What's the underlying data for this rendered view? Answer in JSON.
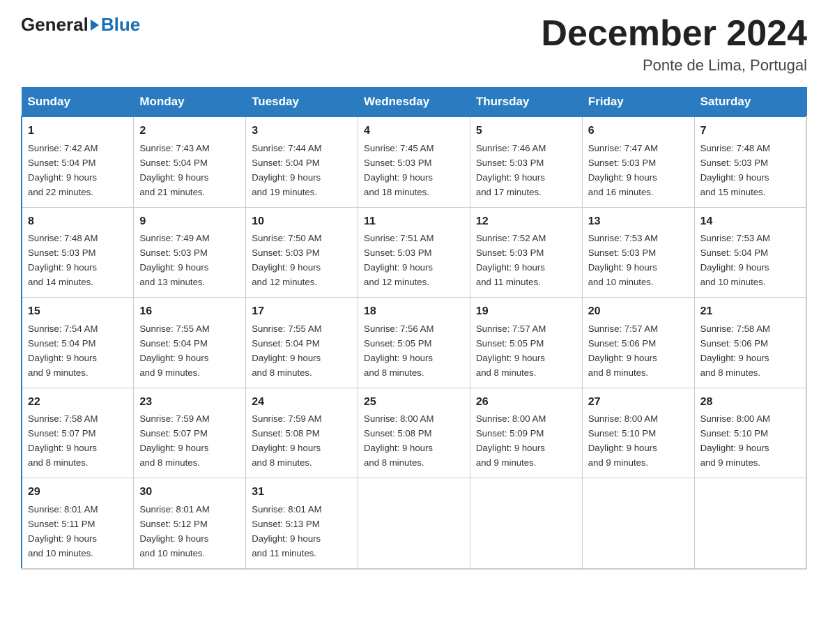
{
  "header": {
    "logo_general": "General",
    "logo_blue": "Blue",
    "title": "December 2024",
    "location": "Ponte de Lima, Portugal"
  },
  "days_of_week": [
    "Sunday",
    "Monday",
    "Tuesday",
    "Wednesday",
    "Thursday",
    "Friday",
    "Saturday"
  ],
  "weeks": [
    [
      {
        "day": "1",
        "info": "Sunrise: 7:42 AM\nSunset: 5:04 PM\nDaylight: 9 hours\nand 22 minutes."
      },
      {
        "day": "2",
        "info": "Sunrise: 7:43 AM\nSunset: 5:04 PM\nDaylight: 9 hours\nand 21 minutes."
      },
      {
        "day": "3",
        "info": "Sunrise: 7:44 AM\nSunset: 5:04 PM\nDaylight: 9 hours\nand 19 minutes."
      },
      {
        "day": "4",
        "info": "Sunrise: 7:45 AM\nSunset: 5:03 PM\nDaylight: 9 hours\nand 18 minutes."
      },
      {
        "day": "5",
        "info": "Sunrise: 7:46 AM\nSunset: 5:03 PM\nDaylight: 9 hours\nand 17 minutes."
      },
      {
        "day": "6",
        "info": "Sunrise: 7:47 AM\nSunset: 5:03 PM\nDaylight: 9 hours\nand 16 minutes."
      },
      {
        "day": "7",
        "info": "Sunrise: 7:48 AM\nSunset: 5:03 PM\nDaylight: 9 hours\nand 15 minutes."
      }
    ],
    [
      {
        "day": "8",
        "info": "Sunrise: 7:48 AM\nSunset: 5:03 PM\nDaylight: 9 hours\nand 14 minutes."
      },
      {
        "day": "9",
        "info": "Sunrise: 7:49 AM\nSunset: 5:03 PM\nDaylight: 9 hours\nand 13 minutes."
      },
      {
        "day": "10",
        "info": "Sunrise: 7:50 AM\nSunset: 5:03 PM\nDaylight: 9 hours\nand 12 minutes."
      },
      {
        "day": "11",
        "info": "Sunrise: 7:51 AM\nSunset: 5:03 PM\nDaylight: 9 hours\nand 12 minutes."
      },
      {
        "day": "12",
        "info": "Sunrise: 7:52 AM\nSunset: 5:03 PM\nDaylight: 9 hours\nand 11 minutes."
      },
      {
        "day": "13",
        "info": "Sunrise: 7:53 AM\nSunset: 5:03 PM\nDaylight: 9 hours\nand 10 minutes."
      },
      {
        "day": "14",
        "info": "Sunrise: 7:53 AM\nSunset: 5:04 PM\nDaylight: 9 hours\nand 10 minutes."
      }
    ],
    [
      {
        "day": "15",
        "info": "Sunrise: 7:54 AM\nSunset: 5:04 PM\nDaylight: 9 hours\nand 9 minutes."
      },
      {
        "day": "16",
        "info": "Sunrise: 7:55 AM\nSunset: 5:04 PM\nDaylight: 9 hours\nand 9 minutes."
      },
      {
        "day": "17",
        "info": "Sunrise: 7:55 AM\nSunset: 5:04 PM\nDaylight: 9 hours\nand 8 minutes."
      },
      {
        "day": "18",
        "info": "Sunrise: 7:56 AM\nSunset: 5:05 PM\nDaylight: 9 hours\nand 8 minutes."
      },
      {
        "day": "19",
        "info": "Sunrise: 7:57 AM\nSunset: 5:05 PM\nDaylight: 9 hours\nand 8 minutes."
      },
      {
        "day": "20",
        "info": "Sunrise: 7:57 AM\nSunset: 5:06 PM\nDaylight: 9 hours\nand 8 minutes."
      },
      {
        "day": "21",
        "info": "Sunrise: 7:58 AM\nSunset: 5:06 PM\nDaylight: 9 hours\nand 8 minutes."
      }
    ],
    [
      {
        "day": "22",
        "info": "Sunrise: 7:58 AM\nSunset: 5:07 PM\nDaylight: 9 hours\nand 8 minutes."
      },
      {
        "day": "23",
        "info": "Sunrise: 7:59 AM\nSunset: 5:07 PM\nDaylight: 9 hours\nand 8 minutes."
      },
      {
        "day": "24",
        "info": "Sunrise: 7:59 AM\nSunset: 5:08 PM\nDaylight: 9 hours\nand 8 minutes."
      },
      {
        "day": "25",
        "info": "Sunrise: 8:00 AM\nSunset: 5:08 PM\nDaylight: 9 hours\nand 8 minutes."
      },
      {
        "day": "26",
        "info": "Sunrise: 8:00 AM\nSunset: 5:09 PM\nDaylight: 9 hours\nand 9 minutes."
      },
      {
        "day": "27",
        "info": "Sunrise: 8:00 AM\nSunset: 5:10 PM\nDaylight: 9 hours\nand 9 minutes."
      },
      {
        "day": "28",
        "info": "Sunrise: 8:00 AM\nSunset: 5:10 PM\nDaylight: 9 hours\nand 9 minutes."
      }
    ],
    [
      {
        "day": "29",
        "info": "Sunrise: 8:01 AM\nSunset: 5:11 PM\nDaylight: 9 hours\nand 10 minutes."
      },
      {
        "day": "30",
        "info": "Sunrise: 8:01 AM\nSunset: 5:12 PM\nDaylight: 9 hours\nand 10 minutes."
      },
      {
        "day": "31",
        "info": "Sunrise: 8:01 AM\nSunset: 5:13 PM\nDaylight: 9 hours\nand 11 minutes."
      },
      {
        "day": "",
        "info": ""
      },
      {
        "day": "",
        "info": ""
      },
      {
        "day": "",
        "info": ""
      },
      {
        "day": "",
        "info": ""
      }
    ]
  ]
}
